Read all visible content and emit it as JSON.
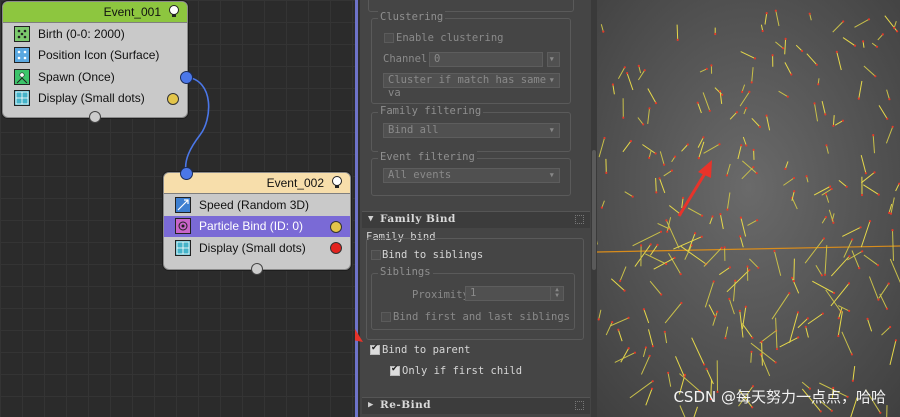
{
  "graph": {
    "event1": {
      "title": "Event_001",
      "operators": [
        {
          "label": "Birth (0-0: 2000)",
          "icon": "birth-icon"
        },
        {
          "label": "Position Icon (Surface)",
          "icon": "position-icon"
        },
        {
          "label": "Spawn (Once)",
          "icon": "spawn-icon"
        },
        {
          "label": "Display (Small dots)",
          "icon": "display-icon"
        }
      ]
    },
    "event2": {
      "title": "Event_002",
      "operators": [
        {
          "label": "Speed (Random 3D)",
          "icon": "speed-icon"
        },
        {
          "label": "Particle Bind (ID: 0)",
          "icon": "particle-bind-icon"
        },
        {
          "label": "Display (Small dots)",
          "icon": "display-icon"
        }
      ]
    },
    "colors": {
      "header1": "#8dc63f",
      "header2": "#f7deab",
      "wire": "#4b77e8",
      "selected": "#7a6ad6"
    }
  },
  "panel": {
    "clustering": {
      "title": "Clustering",
      "enable_label": "Enable clustering",
      "channel_label": "Channel:",
      "channel_value": "0",
      "cluster_dropdown": "Cluster if match has same va"
    },
    "family_filtering": {
      "title": "Family filtering",
      "value": "Bind all"
    },
    "event_filtering": {
      "title": "Event filtering",
      "value": "All events"
    },
    "family_bind_rollout": {
      "title": "Family Bind",
      "section_label": "Family bind",
      "bind_siblings_label": "Bind to siblings",
      "siblings_group_title": "Siblings",
      "proximity_label": "Proximity",
      "proximity_value": "1",
      "bind_first_last_label": "Bind first and last siblings",
      "bind_parent_label": "Bind to parent",
      "bind_parent_checked": true,
      "only_first_child_label": "Only if first child",
      "only_first_child_checked": true
    },
    "rebind_rollout": {
      "title": "Re-Bind"
    }
  },
  "viewport": {
    "watermark": "CSDN @每天努力一点点，哈哈"
  }
}
